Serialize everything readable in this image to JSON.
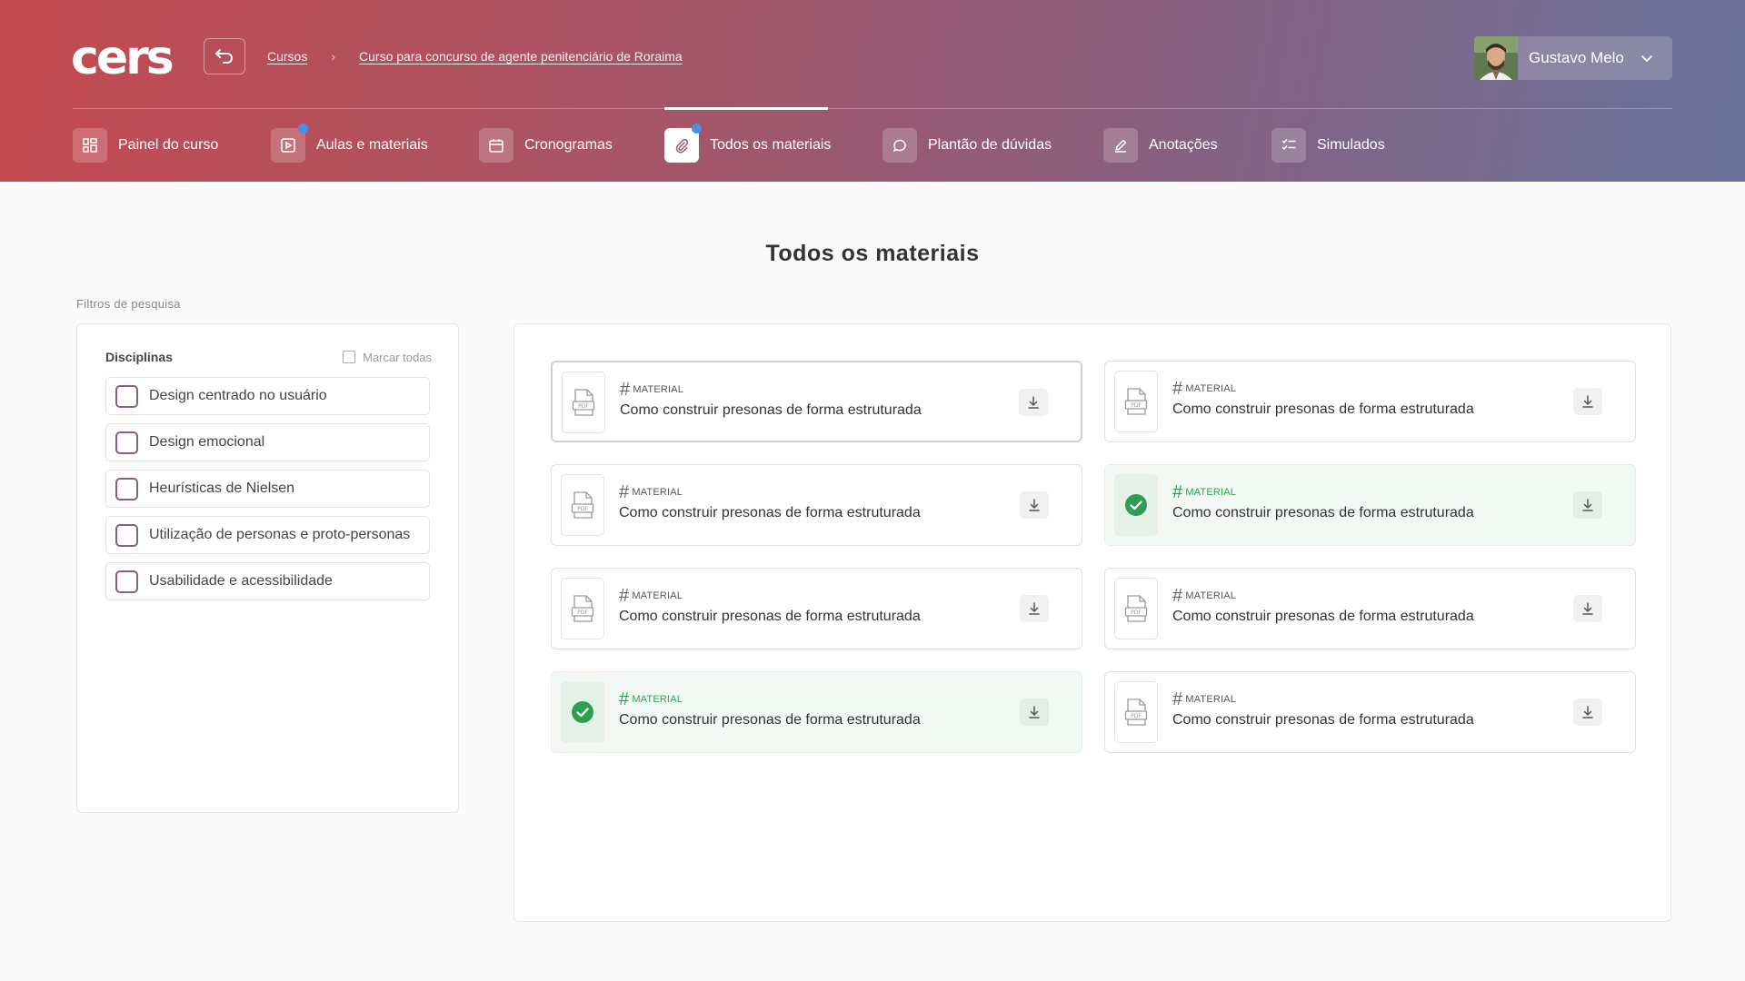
{
  "header": {
    "logo": "cers",
    "breadcrumb": [
      "Cursos",
      "Curso para concurso de agente penitenciário de Roraima"
    ],
    "user": {
      "name": "Gustavo Melo"
    }
  },
  "nav": {
    "items": [
      {
        "label": "Painel do curso",
        "icon": "dashboard-icon",
        "active": false,
        "dot": false
      },
      {
        "label": "Aulas e materiais",
        "icon": "play-icon",
        "active": false,
        "dot": true
      },
      {
        "label": "Cronogramas",
        "icon": "calendar-icon",
        "active": false,
        "dot": false
      },
      {
        "label": "Todos os materiais",
        "icon": "paperclip-icon",
        "active": true,
        "dot": true
      },
      {
        "label": "Plantão de dúvidas",
        "icon": "chat-icon",
        "active": false,
        "dot": false
      },
      {
        "label": "Anotações",
        "icon": "pencil-icon",
        "active": false,
        "dot": false
      },
      {
        "label": "Simulados",
        "icon": "checklist-icon",
        "active": false,
        "dot": false
      }
    ]
  },
  "main": {
    "title": "Todos os materiais",
    "filters_label": "Filtros de pesquisa",
    "filters": {
      "heading": "Disciplinas",
      "mark_all": "Marcar todas",
      "items": [
        "Design centrado no usuário",
        "Design emocional",
        "Heurísticas de Nielsen",
        "Utilização de personas e proto-personas",
        "Usabilidade e acessibilidade"
      ]
    },
    "materials": [
      {
        "tag": "MATERIAL",
        "title": "Como construir presonas de forma estruturada",
        "done": false
      },
      {
        "tag": "MATERIAL",
        "title": "Como construir presonas de forma estruturada",
        "done": false
      },
      {
        "tag": "MATERIAL",
        "title": "Como construir presonas de forma estruturada",
        "done": false
      },
      {
        "tag": "MATERIAL",
        "title": "Como construir presonas de forma estruturada",
        "done": true
      },
      {
        "tag": "MATERIAL",
        "title": "Como construir presonas de forma estruturada",
        "done": false
      },
      {
        "tag": "MATERIAL",
        "title": "Como construir presonas de forma estruturada",
        "done": false
      },
      {
        "tag": "MATERIAL",
        "title": "Como construir presonas de forma estruturada",
        "done": true
      },
      {
        "tag": "MATERIAL",
        "title": "Como construir presonas de forma estruturada",
        "done": false
      }
    ],
    "pdf_label": "PDF"
  },
  "colors": {
    "accent": "#8a5f7e",
    "success": "#2f9e55",
    "notification": "#4a8fe2"
  }
}
